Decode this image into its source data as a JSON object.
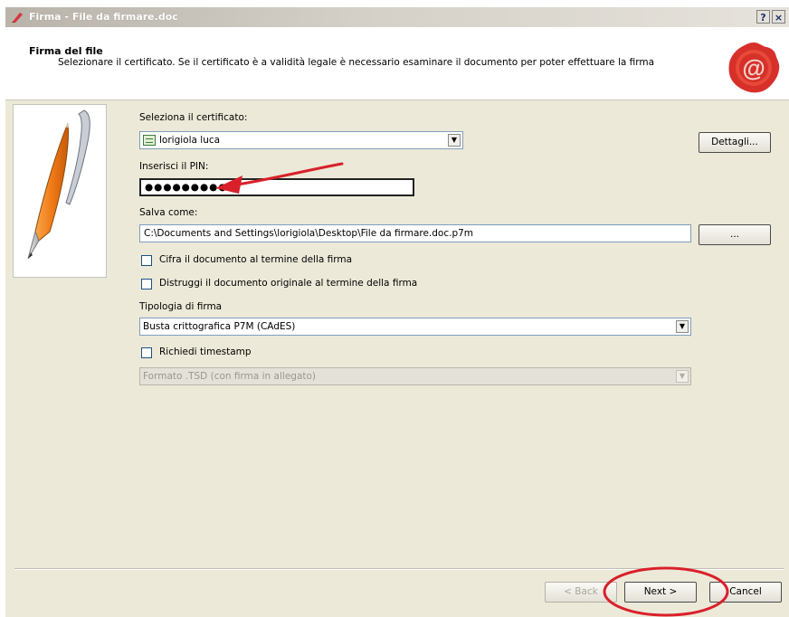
{
  "window": {
    "title": "Firma - File da firmare.doc",
    "help_label": "?",
    "close_label": "×"
  },
  "header": {
    "title": "Firma del file",
    "subtitle": "Selezionare il certificato. Se il certificato è a validità legale è necessario esaminare il documento per poter effettuare la firma"
  },
  "form": {
    "certificate_label": "Seleziona il certificato:",
    "certificate_value": "lorigiola luca",
    "details_button": "Dettagli...",
    "pin_label": "Inserisci il PIN:",
    "pin_value": "●●●●●●●●●",
    "save_as_label": "Salva come:",
    "save_as_value": "C:\\Documents and Settings\\lorigiola\\Desktop\\File da firmare.doc.p7m",
    "browse_button": "...",
    "encrypt_label": "Cifra il documento al termine della firma",
    "destroy_label": "Distruggi il documento originale al termine della firma",
    "signature_type_label": "Tipologia di firma",
    "signature_type_value": "Busta crittografica P7M (CAdES)",
    "timestamp_label": "Richiedi timestamp",
    "timestamp_format_value": "Formato .TSD (con firma in allegato)"
  },
  "footer": {
    "back_button": "< Back",
    "next_button": "Next >",
    "cancel_button": "Cancel"
  },
  "colors": {
    "annotation_red": "#d9202a",
    "seal_red": "#d7302a"
  }
}
